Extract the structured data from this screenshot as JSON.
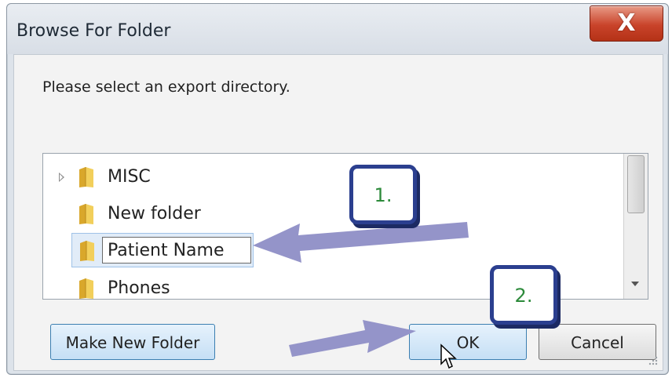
{
  "window": {
    "title": "Browse For Folder"
  },
  "titlebar": {
    "close_glyph": "X",
    "close_icon": "close-icon"
  },
  "prompt": "Please select an export directory.",
  "tree": {
    "items": [
      {
        "label": "MISC",
        "expandable": true,
        "state": "normal",
        "icon": "folder-icon"
      },
      {
        "label": "New folder",
        "expandable": false,
        "state": "normal",
        "icon": "folder-icon"
      },
      {
        "label": "Patient Name",
        "expandable": false,
        "state": "renaming",
        "icon": "folder-icon"
      },
      {
        "label": "Phones",
        "expandable": false,
        "state": "normal",
        "icon": "folder-icon"
      }
    ]
  },
  "buttons": {
    "make_new_folder": "Make New Folder",
    "ok": "OK",
    "cancel": "Cancel"
  },
  "annotations": {
    "step1": "1.",
    "step2": "2.",
    "arrow_color": "#9494c9",
    "callout_border": "#2b3f8f",
    "callout_text_color": "#2c8a3a"
  },
  "colors": {
    "close_button": "#c9432a",
    "selection": "#e1ecf8",
    "default_button": "#c5dff5"
  }
}
